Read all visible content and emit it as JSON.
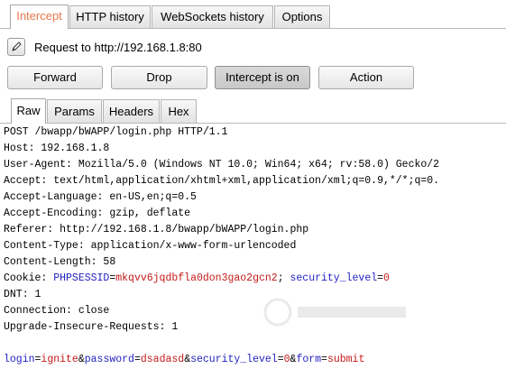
{
  "top_tabs": [
    "Intercept",
    "HTTP history",
    "WebSockets history",
    "Options"
  ],
  "request": {
    "label": "Request to http://192.168.1.8:80"
  },
  "buttons": {
    "forward": "Forward",
    "drop": "Drop",
    "intercept": "Intercept is on",
    "action": "Action"
  },
  "sub_tabs": [
    "Raw",
    "Params",
    "Headers",
    "Hex"
  ],
  "raw": {
    "line1": "POST /bwapp/bWAPP/login.php HTTP/1.1",
    "host": "Host: 192.168.1.8",
    "user_agent": "User-Agent: Mozilla/5.0 (Windows NT 10.0; Win64; x64; rv:58.0) Gecko/2",
    "accept": "Accept: text/html,application/xhtml+xml,application/xml;q=0.9,*/*;q=0.",
    "accept_language": "Accept-Language: en-US,en;q=0.5",
    "accept_encoding": "Accept-Encoding: gzip, deflate",
    "referer": "Referer: http://192.168.1.8/bwapp/bWAPP/login.php",
    "content_type": "Content-Type: application/x-www-form-urlencoded",
    "content_length": "Content-Length: 58",
    "cookie": {
      "prefix": "Cookie: ",
      "name1": "PHPSESSID",
      "eq1": "=",
      "value1": "mkqvv6jqdbfla0don3gao2gcn2",
      "sep": "; ",
      "name2": "security_level",
      "eq2": "=",
      "value2": "0"
    },
    "dnt": "DNT: 1",
    "connection": "Connection: close",
    "upgrade": "Upgrade-Insecure-Requests: 1",
    "body": {
      "k1": "login",
      "eq1": "=",
      "v1": "ignite",
      "amp1": "&",
      "k2": "password",
      "eq2": "=",
      "v2": "dsadasd",
      "amp2": "&",
      "k3": "security_level",
      "eq3": "=",
      "v3": "0",
      "amp3": "&",
      "k4": "form",
      "eq4": "=",
      "v4": "submit"
    }
  },
  "colors": {
    "active_tab": "#e8774a",
    "param_name": "#1f1fbf",
    "param_value": "#c41a1a"
  }
}
